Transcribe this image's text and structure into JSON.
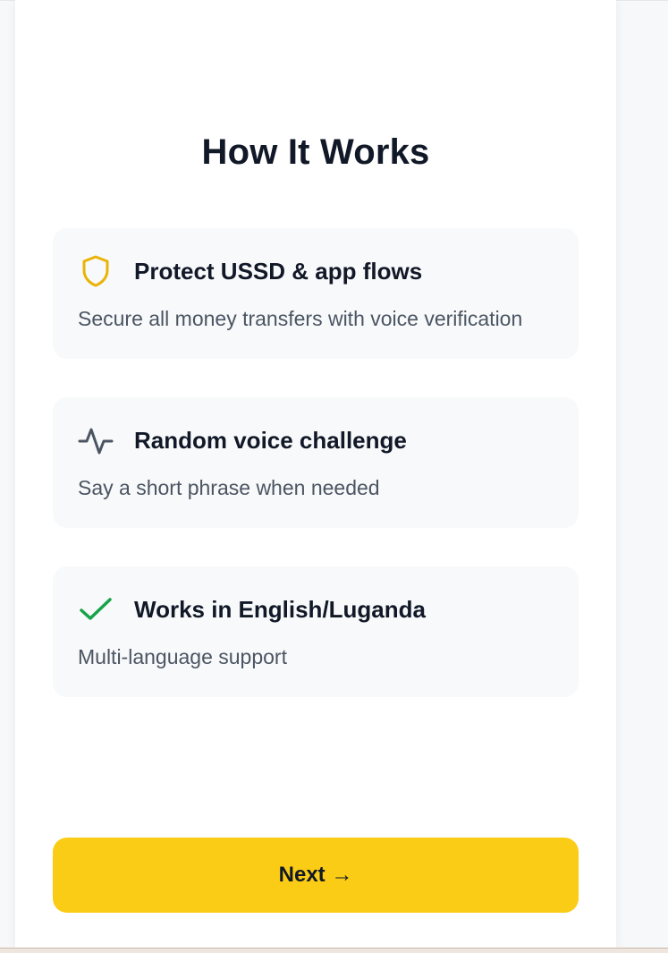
{
  "page": {
    "title": "How It Works"
  },
  "features": [
    {
      "icon": "shield-icon",
      "title": "Protect USSD & app flows",
      "description": "Secure all money transfers with voice verification"
    },
    {
      "icon": "activity-waveform-icon",
      "title": "Random voice challenge",
      "description": "Say a short phrase when needed"
    },
    {
      "icon": "checkmark-icon",
      "title": "Works in English/Luganda",
      "description": "Multi-language support"
    }
  ],
  "actions": {
    "next_label": "Next →"
  },
  "colors": {
    "accent": "#facc15",
    "shield_icon": "#eab308",
    "waveform_icon": "#4b5563",
    "check_icon": "#16a34a",
    "card_background": "#f8f9fa",
    "title_text": "#111827",
    "body_text": "#4b5563"
  }
}
